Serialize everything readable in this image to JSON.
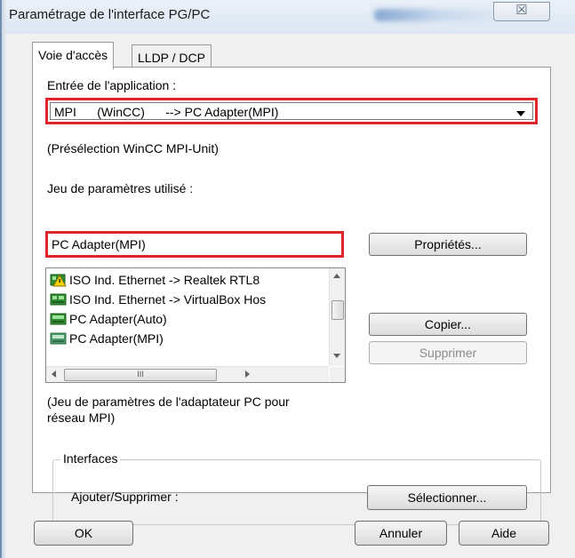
{
  "window": {
    "title": "Paramétrage de l'interface PG/PC",
    "close_glyph": "☒"
  },
  "tabs": [
    {
      "label": "Voie d'accès",
      "active": true
    },
    {
      "label": "LLDP / DCP",
      "active": false
    }
  ],
  "access_path": {
    "app_entry_label": "Entrée de l'application :",
    "app_entry_value": "MPI      (WinCC)      --> PC Adapter(MPI)",
    "preselection_text": "(Présélection WinCC MPI-Unit)",
    "param_set_label": "Jeu de paramètres utilisé :",
    "param_set_value": "PC Adapter(MPI)",
    "param_list": [
      {
        "label": "ISO Ind. Ethernet -> Realtek RTL8",
        "icon": "network-warning-icon"
      },
      {
        "label": "ISO Ind. Ethernet -> VirtualBox Hos",
        "icon": "network-card-icon"
      },
      {
        "label": "PC Adapter(Auto)",
        "icon": "pc-adapter-icon"
      },
      {
        "label": "PC Adapter(MPI)",
        "icon": "pc-adapter-mpi-icon"
      }
    ],
    "hscroll_grip": "III",
    "description": "(Jeu de paramètres de l'adaptateur PC pour réseau MPI)",
    "description_line1": "(Jeu de paramètres de l'adaptateur PC pour",
    "description_line2": "réseau MPI)",
    "properties_button": "Propriétés...",
    "copy_button": "Copier...",
    "delete_button": "Supprimer",
    "interfaces_group_label": "Interfaces",
    "add_remove_label": "Ajouter/Supprimer :",
    "select_button": "Sélectionner..."
  },
  "footer": {
    "ok_button": "OK",
    "cancel_button": "Annuler",
    "help_button": "Aide"
  },
  "colors": {
    "highlight_border": "#e0252a",
    "dialog_background": "#f0f0f0"
  }
}
